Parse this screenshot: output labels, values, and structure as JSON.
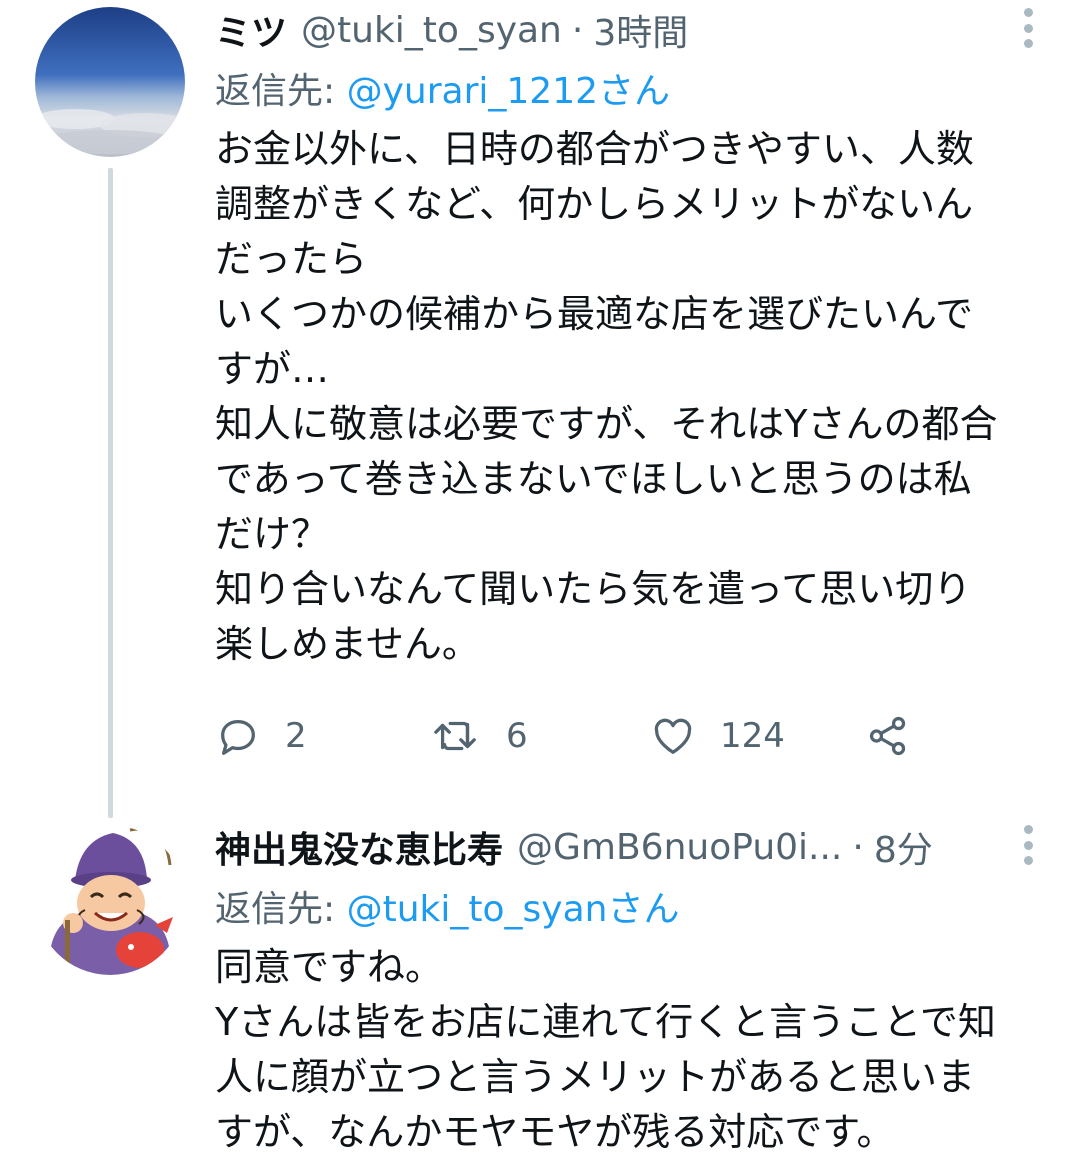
{
  "tweets": [
    {
      "name": "ミツ",
      "handle": "@tuki_to_syan",
      "separator": "·",
      "time": "3時間",
      "reply_label": "返信先:",
      "reply_to": "@yurari_1212さん",
      "body_lines": [
        "お金以外に、日時の都合がつきやすい、人数",
        "調整がきくなど、何かしらメリットがないん",
        "だったら",
        "いくつかの候補から最適な店を選びたいんで",
        "すが…",
        "知人に敬意は必要ですが、それはYさんの都合",
        "であって巻き込まないでほしいと思うのは私",
        "だけ？",
        "知り合いなんて聞いたら気を遣って思い切り",
        "楽しめません。"
      ],
      "stats": {
        "replies": "2",
        "retweets": "6",
        "likes": "124"
      },
      "avatar_icon": "sky-clouds-photo"
    },
    {
      "name": "神出鬼没な恵比寿",
      "handle": "@GmB6nuoPu0i...",
      "separator": "·",
      "time": "8分",
      "reply_label": "返信先:",
      "reply_to": "@tuki_to_syanさん",
      "body_lines": [
        "同意ですね。",
        "Yさんは皆をお店に連れて行くと言うことで知",
        "人に顔が立つと言うメリットがあると思いま",
        "すが、なんかモヤモヤが残る対応です。"
      ],
      "avatar_icon": "ebisu-illustration"
    }
  ],
  "colors": {
    "text": "#0f1419",
    "secondary": "#536471",
    "link": "#1d9bf0",
    "thread_line": "#cfd9de"
  },
  "icons": [
    "reply-icon",
    "retweet-icon",
    "like-icon",
    "share-icon",
    "more-icon"
  ]
}
